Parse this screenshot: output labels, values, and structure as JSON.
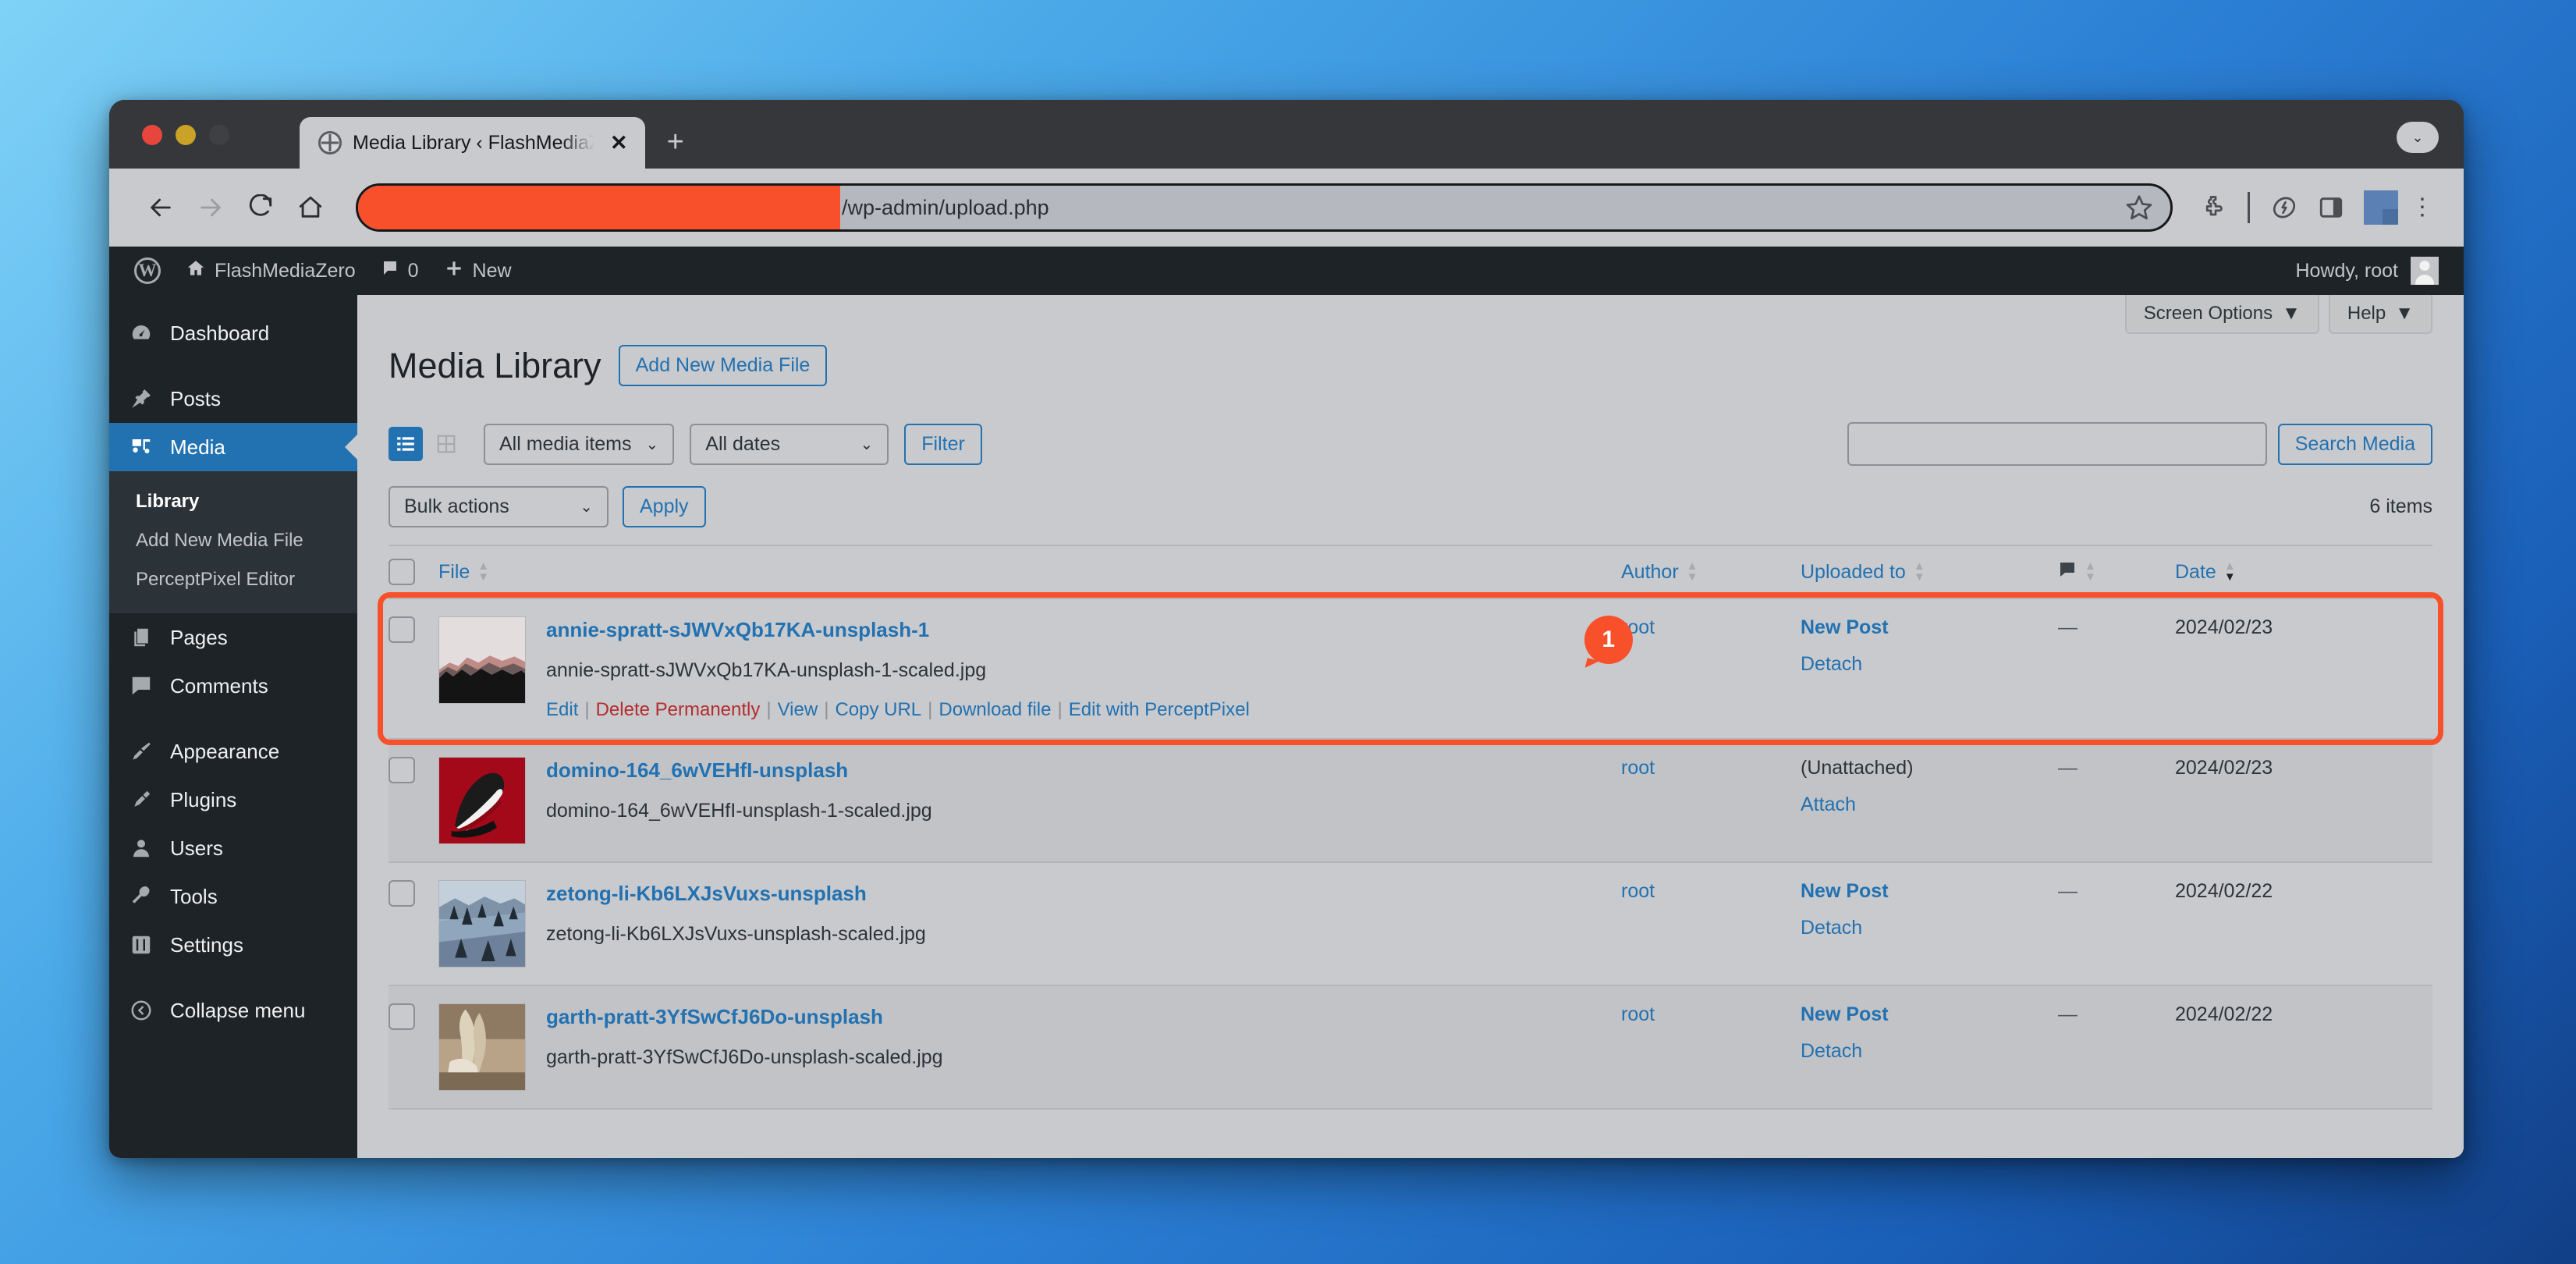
{
  "browser": {
    "tab_title": "Media Library ‹ FlashMediaZ",
    "tab_close_label": "✕",
    "new_tab_label": "+",
    "window_menu_label": "⌄",
    "url_path": "/wp-admin/upload.php",
    "nav": {
      "back_label": "←",
      "forward_label": "→",
      "reload_label": "⟳",
      "home_label": "⌂"
    },
    "menu_dots": "⋮"
  },
  "adminbar": {
    "site_name": "FlashMediaZero",
    "comment_count": "0",
    "new_label": "New",
    "howdy": "Howdy, root"
  },
  "sidebar": {
    "items": [
      {
        "label": "Dashboard",
        "icon": "dashboard-icon"
      },
      {
        "label": "Posts",
        "icon": "pin-icon"
      },
      {
        "label": "Media",
        "icon": "media-icon"
      },
      {
        "label": "Pages",
        "icon": "pages-icon"
      },
      {
        "label": "Comments",
        "icon": "comments-icon"
      },
      {
        "label": "Appearance",
        "icon": "brush-icon"
      },
      {
        "label": "Plugins",
        "icon": "plug-icon"
      },
      {
        "label": "Users",
        "icon": "user-icon"
      },
      {
        "label": "Tools",
        "icon": "wrench-icon"
      },
      {
        "label": "Settings",
        "icon": "sliders-icon"
      },
      {
        "label": "Collapse menu",
        "icon": "collapse-icon"
      }
    ],
    "submenu": [
      {
        "label": "Library"
      },
      {
        "label": "Add New Media File"
      },
      {
        "label": "PerceptPixel Editor"
      }
    ]
  },
  "screen_meta": {
    "screen_options_label": "Screen Options",
    "help_label": "Help",
    "caret": "▼"
  },
  "page": {
    "title": "Media Library",
    "add_new_label": "Add New Media File"
  },
  "filters": {
    "list_view_icon": "list-view-icon",
    "grid_view_icon": "grid-view-icon",
    "media_type_value": "All media items",
    "dates_value": "All dates",
    "filter_button": "Filter",
    "chevron": "⌄"
  },
  "search": {
    "value": "",
    "placeholder": "",
    "button_label": "Search Media"
  },
  "bulk": {
    "actions_value": "Bulk actions",
    "apply_label": "Apply",
    "items_count": "6 items"
  },
  "table": {
    "columns": {
      "file": "File",
      "author": "Author",
      "uploaded_to": "Uploaded to",
      "comments_icon": "comment-bubble-icon",
      "date": "Date"
    },
    "rows": [
      {
        "title": "annie-spratt-sJWVxQb17KA-unsplash-1",
        "filename": "annie-spratt-sJWVxQb17KA-unsplash-1-scaled.jpg",
        "author": "root",
        "uploaded_to": "New Post",
        "uploaded_action": "Detach",
        "comments": "—",
        "date": "2024/02/23",
        "actions": {
          "edit": "Edit",
          "delete": "Delete Permanently",
          "view": "View",
          "copy_url": "Copy URL",
          "download": "Download file",
          "edit_with": "Edit with PerceptPixel"
        }
      },
      {
        "title": "domino-164_6wVEHfI-unsplash",
        "filename": "domino-164_6wVEHfI-unsplash-1-scaled.jpg",
        "author": "root",
        "uploaded_to": "(Unattached)",
        "uploaded_action": "Attach",
        "comments": "—",
        "date": "2024/02/23"
      },
      {
        "title": "zetong-li-Kb6LXJsVuxs-unsplash",
        "filename": "zetong-li-Kb6LXJsVuxs-unsplash-scaled.jpg",
        "author": "root",
        "uploaded_to": "New Post",
        "uploaded_action": "Detach",
        "comments": "—",
        "date": "2024/02/22"
      },
      {
        "title": "garth-pratt-3YfSwCfJ6Do-unsplash",
        "filename": "garth-pratt-3YfSwCfJ6Do-unsplash-scaled.jpg",
        "author": "root",
        "uploaded_to": "New Post",
        "uploaded_action": "Detach",
        "comments": "—",
        "date": "2024/02/22"
      }
    ]
  },
  "annotation": {
    "badge_number": "1",
    "highlight_color": "#f8502a"
  }
}
